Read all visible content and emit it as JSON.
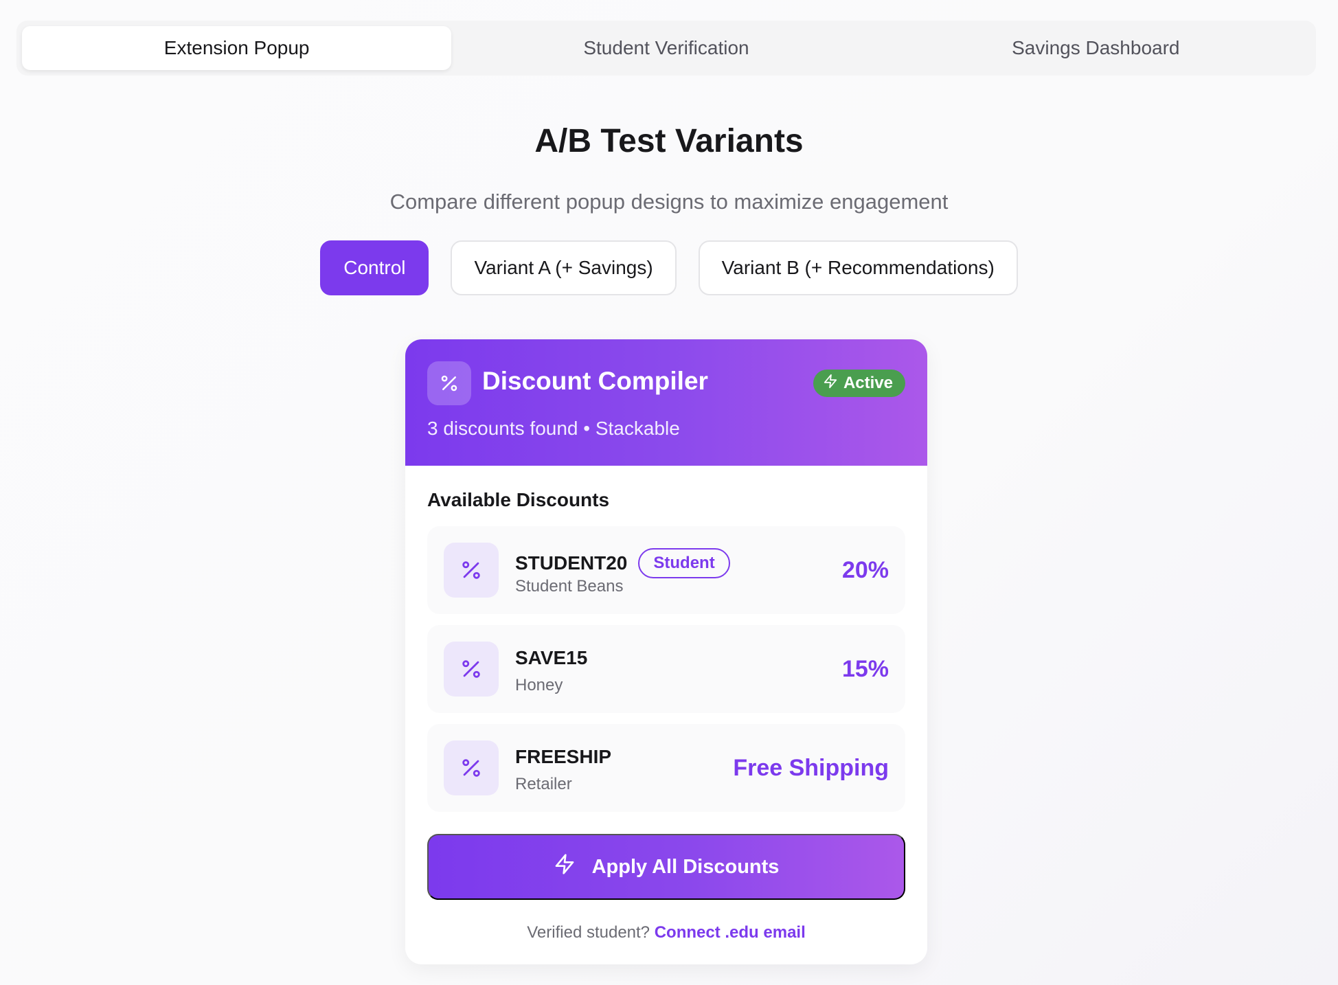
{
  "tabs": [
    {
      "label": "Extension Popup",
      "active": true
    },
    {
      "label": "Student Verification",
      "active": false
    },
    {
      "label": "Savings Dashboard",
      "active": false
    }
  ],
  "heading": {
    "title": "A/B Test Variants",
    "subtitle": "Compare different popup designs to maximize engagement"
  },
  "variants": [
    {
      "label": "Control",
      "active": true
    },
    {
      "label": "Variant A (+ Savings)",
      "active": false
    },
    {
      "label": "Variant B (+ Recommendations)",
      "active": false
    }
  ],
  "popup": {
    "title": "Discount Compiler",
    "status_badge": "Active",
    "summary": "3 discounts found • Stackable",
    "section_label": "Available Discounts",
    "discounts": [
      {
        "code": "STUDENT20",
        "badge": "Student",
        "source": "Student Beans",
        "value": "20%",
        "icon": "percent-icon"
      },
      {
        "code": "SAVE15",
        "badge": "",
        "source": "Honey",
        "value": "15%",
        "icon": "percent-icon"
      },
      {
        "code": "FREESHIP",
        "badge": "",
        "source": "Retailer",
        "value": "Free Shipping",
        "icon": "percent-icon"
      }
    ],
    "apply_button": "Apply All Discounts",
    "footer_text": "Verified student?",
    "footer_link": "Connect .edu email"
  },
  "colors": {
    "accent": "#7c3aed",
    "accent_light": "#ede7fb",
    "active_badge": "#4a9e4f",
    "gradient_end": "#ab58ea"
  }
}
